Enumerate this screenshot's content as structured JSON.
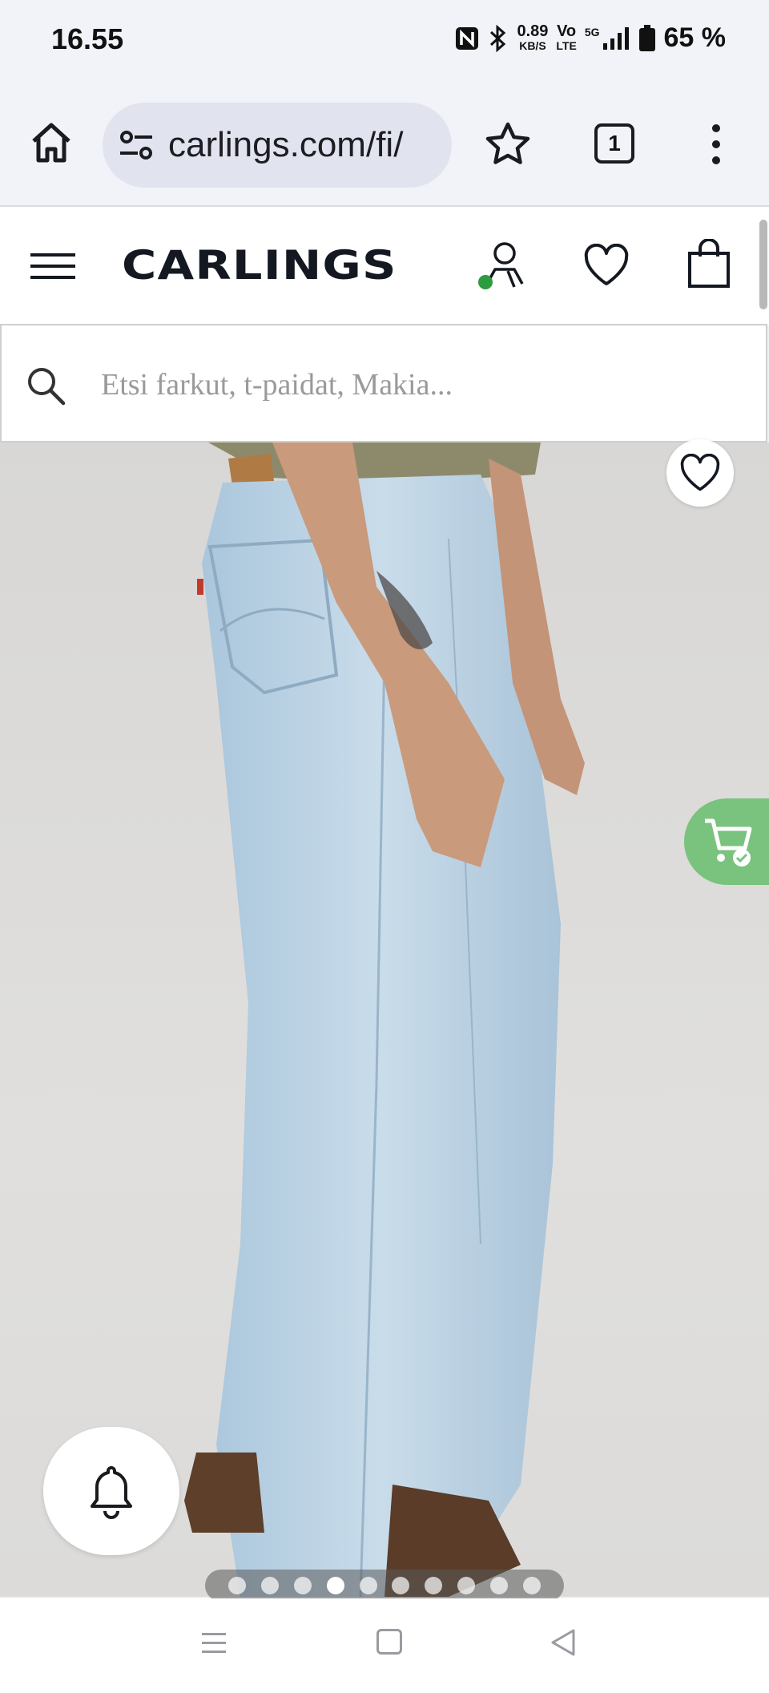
{
  "status_bar": {
    "time": "16.55",
    "net_speed": "0.89",
    "net_unit": "KB/S",
    "volte_top": "Vo",
    "volte_bottom": "LTE",
    "signal": "5G",
    "battery": "65 %"
  },
  "browser": {
    "url": "carlings.com/fi/",
    "tab_count": "1"
  },
  "site": {
    "logo": "CARLINGS"
  },
  "search": {
    "placeholder": "Etsi farkut, t-paidat, Makia..."
  },
  "carousel": {
    "total_slides": 10,
    "active_index": 3
  },
  "colors": {
    "accent_green": "#79c37f",
    "status_dot": "#2e9b3e"
  },
  "icons": {
    "home": "home-icon",
    "site_settings": "tune-icon",
    "bookmark": "star-icon",
    "menu": "more-vert-icon",
    "hamburger": "hamburger-icon",
    "account": "account-icon",
    "wishlist": "heart-icon",
    "bag": "shopping-bag-icon",
    "search": "search-icon",
    "cart": "cart-check-icon",
    "notifications": "bell-icon"
  }
}
